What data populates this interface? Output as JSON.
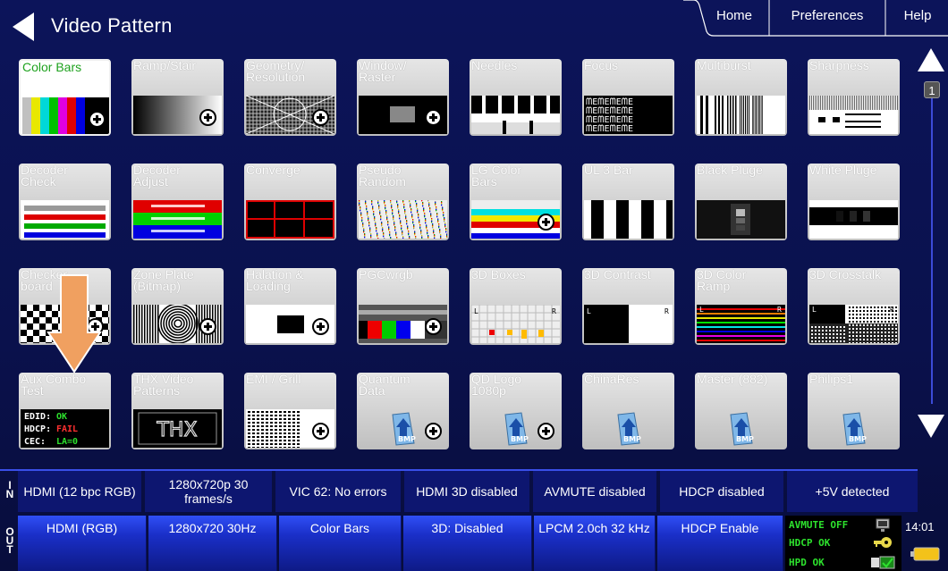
{
  "header": {
    "title": "Video Pattern",
    "tabs": [
      {
        "label": "Home"
      },
      {
        "label": "Preferences"
      },
      {
        "label": "Help"
      }
    ]
  },
  "patterns": [
    {
      "label": "Color Bars",
      "selected": true
    },
    {
      "label": "Ramp/Stair"
    },
    {
      "label": "Geometry/\nResolution"
    },
    {
      "label": "Window/\nRaster"
    },
    {
      "label": "Needles"
    },
    {
      "label": "Focus"
    },
    {
      "label": "Multiburst"
    },
    {
      "label": "Sharpness"
    },
    {
      "label": "Decoder\nCheck"
    },
    {
      "label": "Decoder\nAdjust"
    },
    {
      "label": "Converge"
    },
    {
      "label": "Pseudo\nRandom"
    },
    {
      "label": "LG Color\nBars"
    },
    {
      "label": "UL 3 Bar"
    },
    {
      "label": "Black Pluge"
    },
    {
      "label": "White Pluge"
    },
    {
      "label": "Checker\nboard"
    },
    {
      "label": "Zone Plate\n(Bitmap)"
    },
    {
      "label": "Halation &\nLoading"
    },
    {
      "label": "PGCwrgb"
    },
    {
      "label": "3D Boxes"
    },
    {
      "label": "3D Contrast"
    },
    {
      "label": "3D Color\nRamp"
    },
    {
      "label": "3D Crosstalk"
    },
    {
      "label": "Aux Combo\nTest"
    },
    {
      "label": "THX Video\nPatterns"
    },
    {
      "label": "EMI / Grill"
    },
    {
      "label": "Quantum\nData"
    },
    {
      "label": "QD Logo\n1080p"
    },
    {
      "label": "ChinaRes"
    },
    {
      "label": "Master (882)"
    },
    {
      "label": "Philips1"
    }
  ],
  "thumb_text": {
    "focus": "ᗰEᗰEᗰEᗰE",
    "thx": "THX",
    "bmp": "BMP",
    "aux": [
      {
        "key": "EDID:",
        "val": "OK",
        "color": "#2de22d"
      },
      {
        "key": "HDCP:",
        "val": "FAIL",
        "color": "#ff3030"
      },
      {
        "key": "CEC:",
        "val": "LA=0",
        "color": "#2de22d"
      }
    ],
    "left_eye": "L",
    "right_eye": "R"
  },
  "pager": {
    "page": "1"
  },
  "input_status": {
    "label": "IN",
    "cells": [
      "HDMI (12 bpc RGB)",
      "1280x720p 30 frames/s",
      "VIC 62: No errors",
      "HDMI 3D disabled",
      "AVMUTE disabled",
      "HDCP disabled",
      "+5V detected"
    ]
  },
  "output_status": {
    "label": "OUT",
    "buttons": [
      "HDMI (RGB)",
      "1280x720 30Hz",
      "Color Bars",
      "3D: Disabled",
      "LPCM 2.0ch 32 kHz",
      "HDCP Enable"
    ],
    "indicators": [
      "AVMUTE OFF",
      "HDCP OK",
      "HPD OK"
    ]
  },
  "clock": "14:01",
  "colors": {
    "accent_green": "#2de22d",
    "fail_red": "#ff3030",
    "highlight_arrow": "#f0a060"
  }
}
